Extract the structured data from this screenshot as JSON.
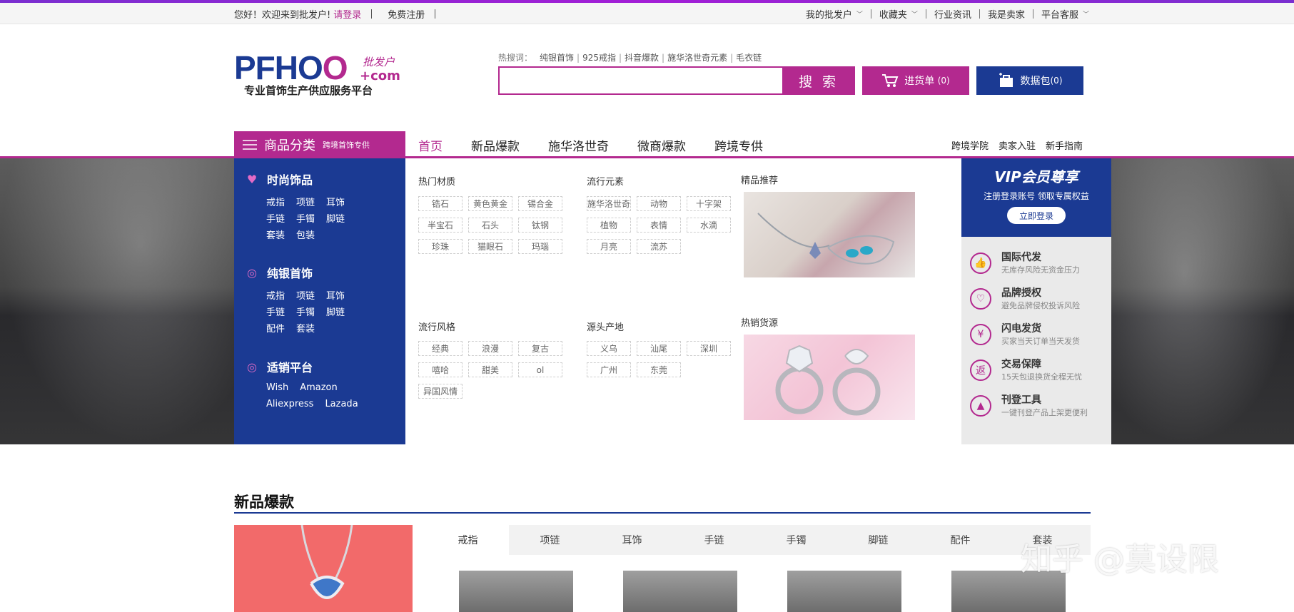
{
  "topbar": {
    "welcome": "您好！欢迎来到批发户!",
    "login": "请登录",
    "register": "免费注册",
    "right": [
      "我的批发户",
      "收藏夹",
      "行业资讯",
      "我是卖家",
      "平台客服"
    ]
  },
  "logo": {
    "brand_main": "PFHO",
    "brand_accent": "O",
    "cn_mark": "批发户",
    "dotcom": "+com",
    "slogan": "专业首饰生产供应服务平台"
  },
  "search": {
    "hot_label": "热搜词：",
    "hot_words": [
      "纯银首饰",
      "925戒指",
      "抖音爆款",
      "施华洛世奇元素",
      "毛衣链"
    ],
    "value": "",
    "button": "搜 索"
  },
  "cart": {
    "label": "进货单",
    "count": "(0)"
  },
  "datapack": {
    "label": "数据包",
    "count": "(0)"
  },
  "nav": {
    "category_title": "商品分类",
    "category_sub": "跨境首饰专供",
    "items": [
      "首页",
      "新品爆款",
      "施华洛世奇",
      "微商爆款",
      "跨境专供"
    ],
    "right": [
      "跨境学院",
      "卖家入驻",
      "新手指南"
    ]
  },
  "categories": [
    {
      "title": "时尚饰品",
      "rows": [
        [
          "戒指",
          "项链",
          "耳饰"
        ],
        [
          "手链",
          "手镯",
          "脚链"
        ],
        [
          "套装",
          "包装"
        ]
      ]
    },
    {
      "title": "纯银首饰",
      "rows": [
        [
          "戒指",
          "项链",
          "耳饰"
        ],
        [
          "手链",
          "手镯",
          "脚链"
        ],
        [
          "配件",
          "套装"
        ]
      ]
    },
    {
      "title": "适销平台",
      "rows": [
        [
          "Wish",
          "Amazon"
        ],
        [
          "Aliexpress",
          "Lazada"
        ]
      ]
    }
  ],
  "sections": {
    "materials": {
      "title": "热门材质",
      "tags": [
        "锆石",
        "黄色黄金",
        "锡合金",
        "半宝石",
        "石头",
        "钛钢",
        "珍珠",
        "猫眼石",
        "玛瑙"
      ]
    },
    "elements": {
      "title": "流行元素",
      "tags": [
        "施华洛世奇",
        "动物",
        "十字架",
        "植物",
        "表情",
        "水滴",
        "月亮",
        "流苏"
      ]
    },
    "styles": {
      "title": "流行风格",
      "tags": [
        "经典",
        "浪漫",
        "复古",
        "嘻哈",
        "甜美",
        "ol",
        "异国风情"
      ]
    },
    "origins": {
      "title": "源头产地",
      "tags": [
        "义乌",
        "汕尾",
        "深圳",
        "广州",
        "东莞"
      ]
    },
    "featured": {
      "title": "精品推荐"
    },
    "hot": {
      "title": "热销货源"
    }
  },
  "vip": {
    "title": "VIP会员尊享",
    "subtitle": "注册登录账号 领取专属权益",
    "button": "立即登录",
    "services": [
      {
        "icon": "thumb-icon",
        "glyph": "👍",
        "title": "国际代发",
        "desc": "无库存风险无资金压力"
      },
      {
        "icon": "heart-icon",
        "glyph": "♡",
        "title": "品牌授权",
        "desc": "避免品牌侵权投诉风险"
      },
      {
        "icon": "yen-icon",
        "glyph": "¥",
        "title": "闪电发货",
        "desc": "买家当天订单当天发货"
      },
      {
        "icon": "return-icon",
        "glyph": "返",
        "title": "交易保障",
        "desc": "15天包退换货全程无忧"
      },
      {
        "icon": "upload-icon",
        "glyph": "▲",
        "title": "刊登工具",
        "desc": "一键刊登产品上架更便利"
      }
    ]
  },
  "new_products": {
    "title": "新品爆款",
    "tabs": [
      "戒指",
      "项链",
      "耳饰",
      "手链",
      "手镯",
      "脚链",
      "配件",
      "套装"
    ]
  },
  "watermark": "知乎 @莫设限",
  "colors": {
    "primary": "#b3298f",
    "navy": "#1b3a93"
  }
}
